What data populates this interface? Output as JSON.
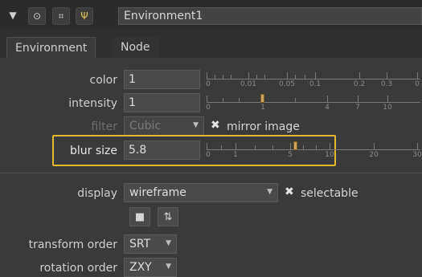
{
  "header": {
    "node_name": "Environment1",
    "icons": [
      "collapse-triangle-icon",
      "circle-toggle-icon",
      "grid-icon",
      "settings-icon"
    ],
    "icon_glyphs": [
      "▼",
      "⊙",
      "⌗",
      "Ψ"
    ]
  },
  "tabs": [
    {
      "label": "Environment",
      "active": true
    },
    {
      "label": "Node",
      "active": false
    }
  ],
  "knobs": {
    "color": {
      "label": "color",
      "value": "1",
      "ticks": [
        "0",
        "0.01",
        "0.05",
        "0.1",
        "0.2",
        "0.3",
        "0"
      ]
    },
    "intensity": {
      "label": "intensity",
      "value": "1",
      "ticks": [
        "0",
        "1",
        "4",
        "7",
        "10"
      ]
    },
    "filter": {
      "label": "filter",
      "value": "Cubic",
      "mirror_label": "mirror image"
    },
    "blur_size": {
      "label": "blur size",
      "value": "5.8",
      "ticks": [
        "0",
        "1",
        "5",
        "10",
        "20",
        "30"
      ]
    },
    "display": {
      "label": "display",
      "value": "wireframe",
      "selectable_label": "selectable"
    },
    "transform_order": {
      "label": "transform order",
      "value": "SRT"
    },
    "rotation_order": {
      "label": "rotation order",
      "value": "ZXY"
    }
  },
  "checkbox_mark": "✖",
  "dropdown_arrow": "▼",
  "action_buttons": [
    {
      "name": "folder-icon",
      "glyph": "■"
    },
    {
      "name": "move-axis-icon",
      "glyph": "⇅"
    }
  ],
  "colors": {
    "highlight": "#e3b82b",
    "slider_handle": "#c9a45a",
    "panel_bg": "#3a3a3a"
  }
}
